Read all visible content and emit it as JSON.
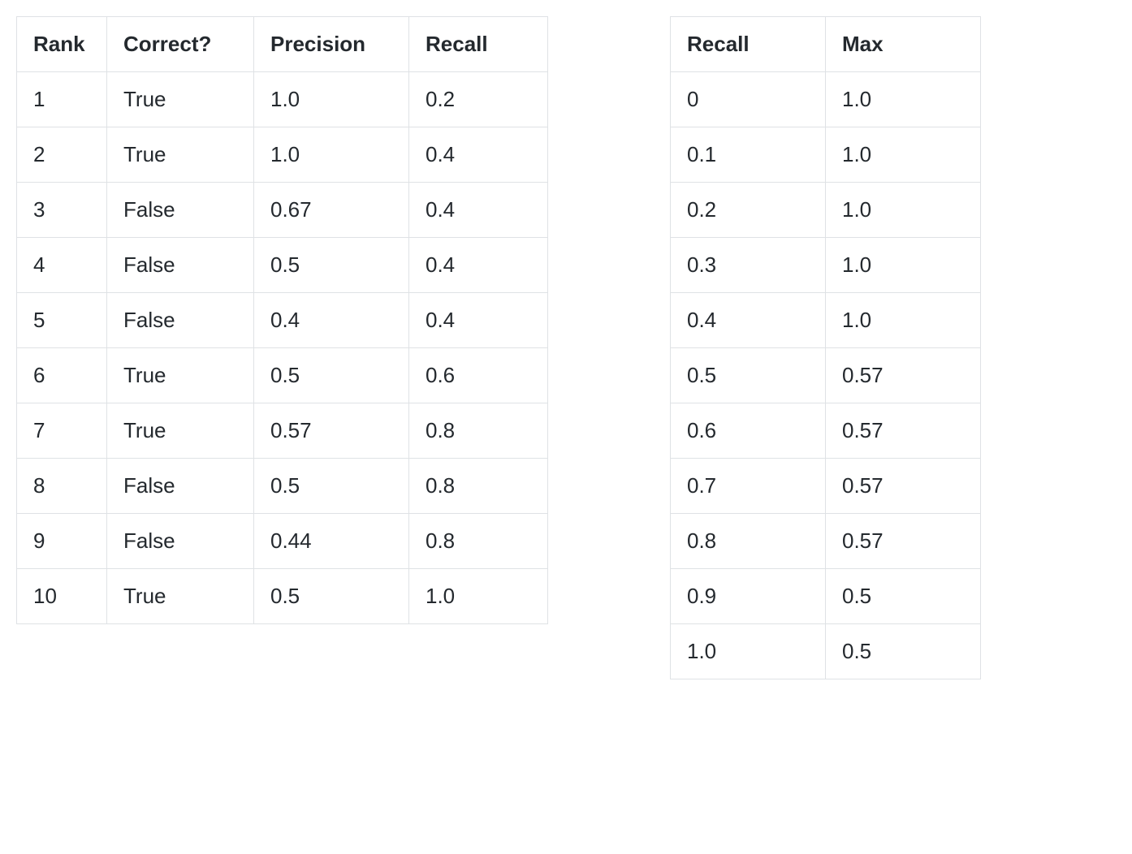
{
  "chart_data": [
    {
      "type": "table",
      "headers": [
        "Rank",
        "Correct?",
        "Precision",
        "Recall"
      ],
      "rows": [
        [
          "1",
          "True",
          "1.0",
          "0.2"
        ],
        [
          "2",
          "True",
          "1.0",
          "0.4"
        ],
        [
          "3",
          "False",
          "0.67",
          "0.4"
        ],
        [
          "4",
          "False",
          "0.5",
          "0.4"
        ],
        [
          "5",
          "False",
          "0.4",
          "0.4"
        ],
        [
          "6",
          "True",
          "0.5",
          "0.6"
        ],
        [
          "7",
          "True",
          "0.57",
          "0.8"
        ],
        [
          "8",
          "False",
          "0.5",
          "0.8"
        ],
        [
          "9",
          "False",
          "0.44",
          "0.8"
        ],
        [
          "10",
          "True",
          "0.5",
          "1.0"
        ]
      ]
    },
    {
      "type": "table",
      "headers": [
        "Recall",
        "Max"
      ],
      "rows": [
        [
          "0",
          "1.0"
        ],
        [
          "0.1",
          "1.0"
        ],
        [
          "0.2",
          "1.0"
        ],
        [
          "0.3",
          "1.0"
        ],
        [
          "0.4",
          "1.0"
        ],
        [
          "0.5",
          "0.57"
        ],
        [
          "0.6",
          "0.57"
        ],
        [
          "0.7",
          "0.57"
        ],
        [
          "0.8",
          "0.57"
        ],
        [
          "0.9",
          "0.5"
        ],
        [
          "1.0",
          "0.5"
        ]
      ]
    }
  ]
}
